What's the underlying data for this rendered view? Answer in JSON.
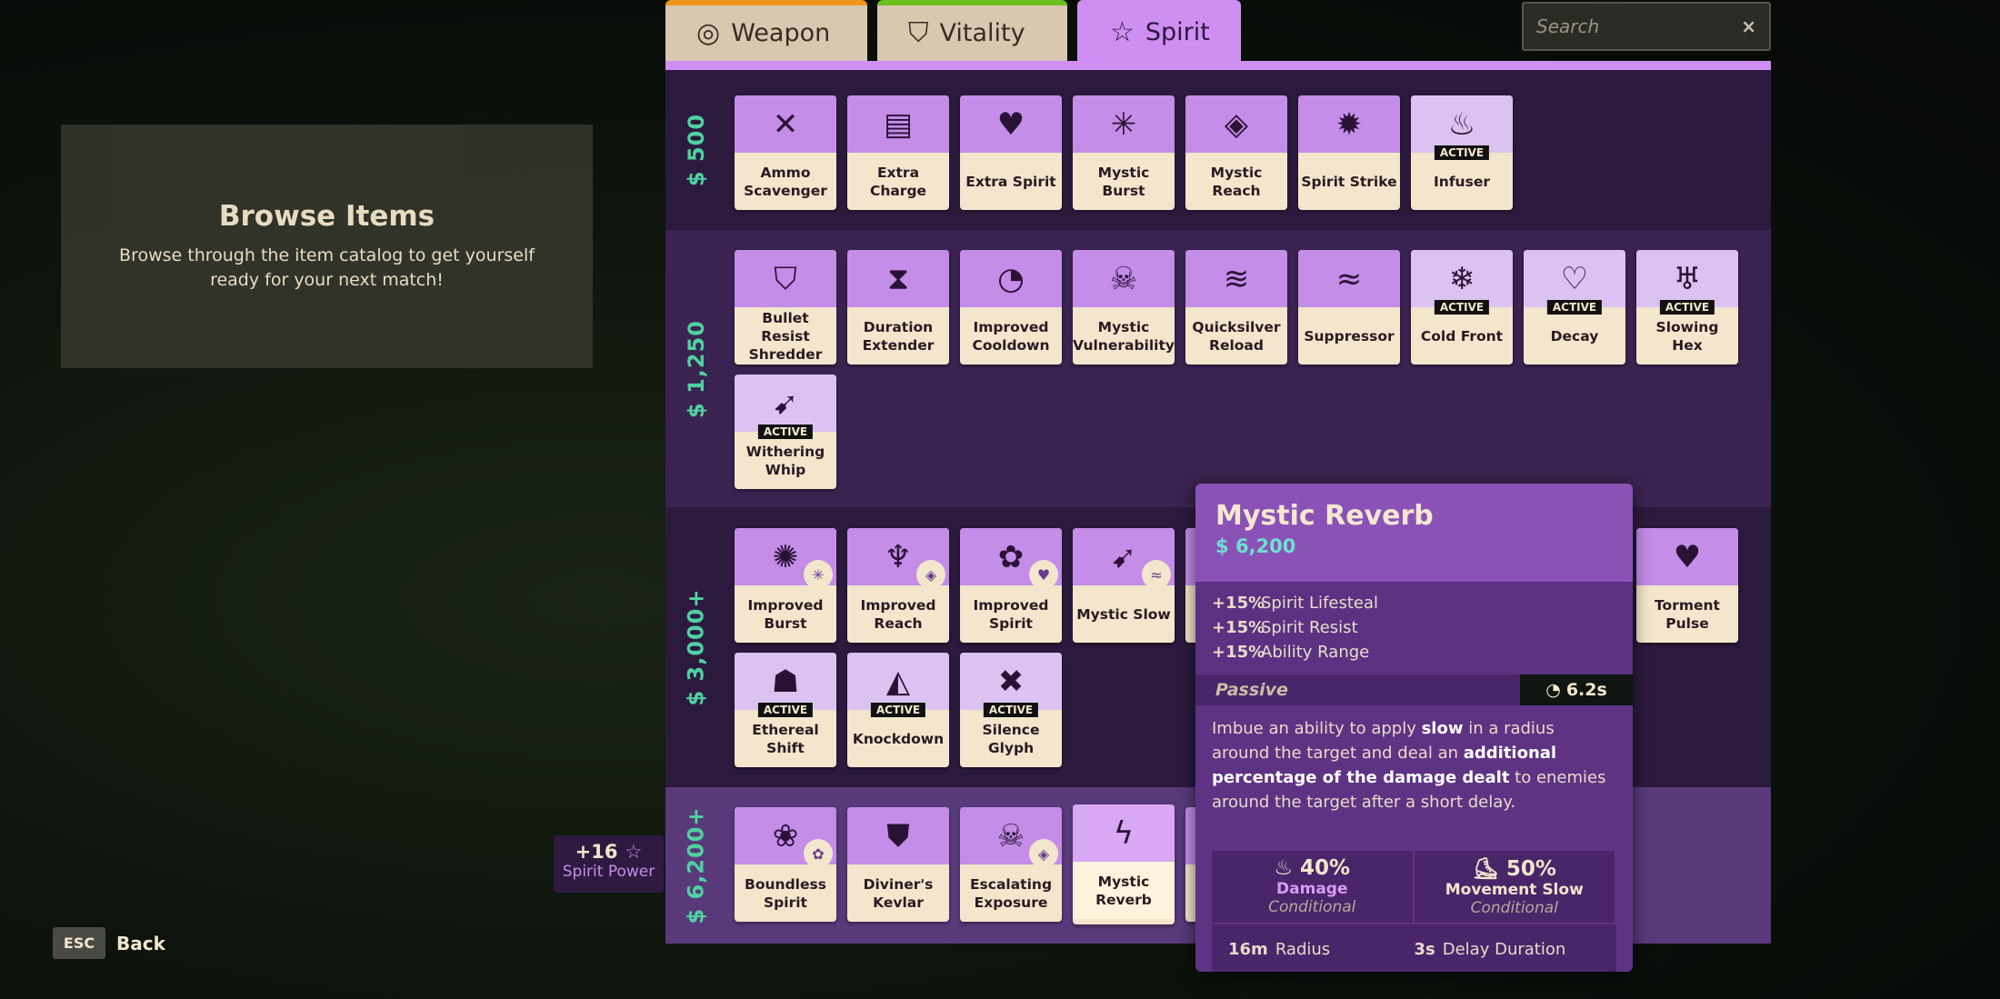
{
  "tabs": [
    {
      "label": "Weapon",
      "icon": "weapon-icon",
      "color": "#f0961e"
    },
    {
      "label": "Vitality",
      "icon": "vitality-icon",
      "color": "#6cc11e"
    },
    {
      "label": "Spirit",
      "icon": "spirit-star-icon",
      "color": "#cf8ff2",
      "selected": true
    }
  ],
  "search": {
    "placeholder": "Search",
    "clear": "×"
  },
  "left_panel": {
    "title": "Browse Items",
    "text": "Browse through the item catalog to get yourself ready for your next match!"
  },
  "sections": [
    {
      "price": "$ 500",
      "items": [
        {
          "name": "Ammo Scavenger",
          "icon": "✕"
        },
        {
          "name": "Extra Charge",
          "icon": "▤"
        },
        {
          "name": "Extra Spirit",
          "icon": "♥"
        },
        {
          "name": "Mystic Burst",
          "icon": "✳"
        },
        {
          "name": "Mystic Reach",
          "icon": "◈"
        },
        {
          "name": "Spirit Strike",
          "icon": "✹"
        },
        {
          "name": "Infuser",
          "icon": "♨",
          "active": true
        }
      ]
    },
    {
      "price": "$ 1,250",
      "items": [
        {
          "name": "Bullet Resist Shredder",
          "icon": "⛉"
        },
        {
          "name": "Duration Extender",
          "icon": "⧗"
        },
        {
          "name": "Improved Cooldown",
          "icon": "◔"
        },
        {
          "name": "Mystic Vulnerability",
          "icon": "☠"
        },
        {
          "name": "Quicksilver Reload",
          "icon": "≋"
        },
        {
          "name": "Suppressor",
          "icon": "≈"
        },
        {
          "name": "Cold Front",
          "icon": "❄",
          "active": true
        },
        {
          "name": "Decay",
          "icon": "♡",
          "active": true
        },
        {
          "name": "Slowing Hex",
          "icon": "♅",
          "active": true
        },
        {
          "name": "Withering Whip",
          "icon": "➹",
          "active": true
        }
      ]
    },
    {
      "price": "$ 3,000+",
      "items": [
        {
          "name": "Improved Burst",
          "icon": "✺",
          "sub": "✳"
        },
        {
          "name": "Improved Reach",
          "icon": "♆",
          "sub": "◈"
        },
        {
          "name": "Improved Spirit",
          "icon": "✿",
          "sub": "♥"
        },
        {
          "name": "Mystic Slow",
          "icon": "➹",
          "sub": "≈"
        },
        {
          "name": "Torment Pulse",
          "icon": "♥"
        },
        {
          "name": "Ethereal Shift",
          "icon": "☗",
          "active": true
        },
        {
          "name": "Knockdown",
          "icon": "◭",
          "active": true
        },
        {
          "name": "Silence Glyph",
          "icon": "✖",
          "active": true
        }
      ]
    },
    {
      "price": "$ 6,200+",
      "items": [
        {
          "name": "Boundless Spirit",
          "icon": "❀",
          "sub": "✿"
        },
        {
          "name": "Diviner's Kevlar",
          "icon": "⛊"
        },
        {
          "name": "Escalating Exposure",
          "icon": "☠",
          "sub": "◈"
        },
        {
          "name": "Mystic Reverb",
          "icon": "ϟ",
          "selected": true
        }
      ]
    }
  ],
  "active_label": "ACTIVE",
  "spirit_power": {
    "value": "+16",
    "label": "Spirit Power"
  },
  "esc": {
    "key": "ESC",
    "label": "Back"
  },
  "tooltip": {
    "title": "Mystic Reverb",
    "cost": "6,200",
    "stats": [
      {
        "value": "+15%",
        "label": "Spirit Lifesteal"
      },
      {
        "value": "+15%",
        "label": "Spirit Resist"
      },
      {
        "value": "+15%",
        "label": "Ability Range"
      }
    ],
    "type": "Passive",
    "cooldown": "6.2s",
    "desc": [
      {
        "t": "Imbue an ability to apply "
      },
      {
        "t": "slow",
        "b": true
      },
      {
        "t": " in a radius around the target and deal an "
      },
      {
        "t": "additional percentage of the damage dealt",
        "b": true
      },
      {
        "t": " to enemies around the target after a short delay."
      }
    ],
    "props": [
      {
        "value": "40%",
        "label": "Damage",
        "cond": "Conditional",
        "color": "#d79af5",
        "icon": "flame-icon"
      },
      {
        "value": "50%",
        "label": "Movement Slow",
        "cond": "Conditional",
        "color": "#f3e6cc",
        "icon": "boot-icon"
      }
    ],
    "extras": [
      {
        "value": "16m",
        "label": "Radius"
      },
      {
        "value": "3s",
        "label": "Delay Duration"
      }
    ]
  }
}
